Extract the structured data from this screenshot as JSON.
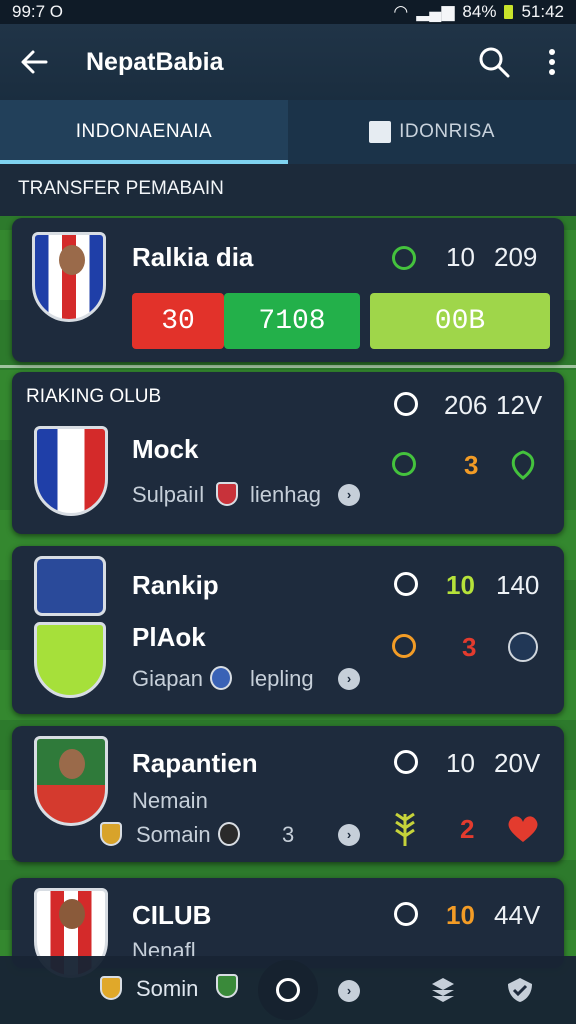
{
  "status": {
    "time": "99:7 O",
    "battery": "84%",
    "clock": "51:42"
  },
  "appbar": {
    "title": "NepatBabia",
    "back_icon": "arrow-left-icon",
    "search_icon": "search-icon",
    "more_icon": "more-vert-icon"
  },
  "tabs": [
    {
      "label": "INDONAENAIA",
      "active": true
    },
    {
      "label": "IDONRISA",
      "active": false
    }
  ],
  "section_title": "TRANSFER PEMABAIN",
  "featured": {
    "name": "Ralkia dia",
    "stat_a": "10",
    "stat_b": "209",
    "btn_red": "30",
    "btn_green": "7108",
    "btn_lime": "00B"
  },
  "ranking": {
    "header": "RIAKING OLUB",
    "header_stat_a": "206",
    "header_stat_b": "12V",
    "name": "Mock",
    "sub_left": "Sulpaiıl",
    "sub_right": "lienhag",
    "num": "3"
  },
  "card3": {
    "title": "Rankip",
    "stat_a": "10",
    "stat_b": "140",
    "name": "PlAok",
    "sub_left": "Giapan",
    "sub_right": "lepling",
    "num": "3"
  },
  "card4": {
    "name": "Rapantien",
    "sub": "Nemain",
    "stat_a": "10",
    "stat_b": "20V",
    "sub_left": "Somain",
    "mid_num": "3",
    "num": "2"
  },
  "card5": {
    "name": "CILUB",
    "sub": "Nenafl",
    "stat_a": "10",
    "stat_b": "44V"
  },
  "bottom": {
    "label": "Somin"
  },
  "colors": {
    "accent": "#7fd3f0",
    "green": "#44c23d",
    "orange": "#f39c26",
    "red": "#e33b2e",
    "lime": "#b6e23a"
  }
}
